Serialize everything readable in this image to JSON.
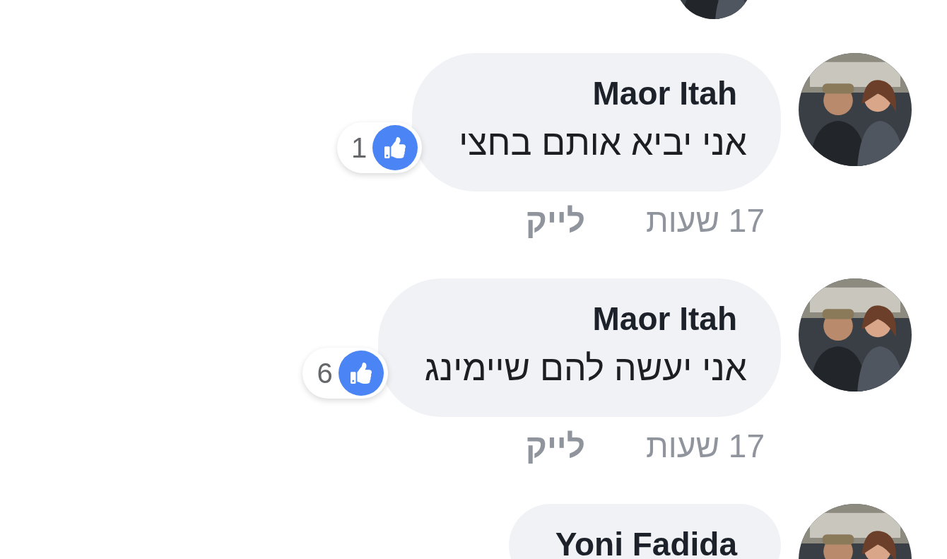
{
  "comments": [
    {
      "name": "Maor Itah",
      "text": "אני יביא אותם בחצי",
      "reactions": "1",
      "time": "17 שעות",
      "like_label": "לייק"
    },
    {
      "name": "Maor Itah",
      "text": "אני יעשה להם שיימינג",
      "reactions": "6",
      "time": "17 שעות",
      "like_label": "לייק"
    },
    {
      "name": "Yoni Fadida"
    }
  ]
}
